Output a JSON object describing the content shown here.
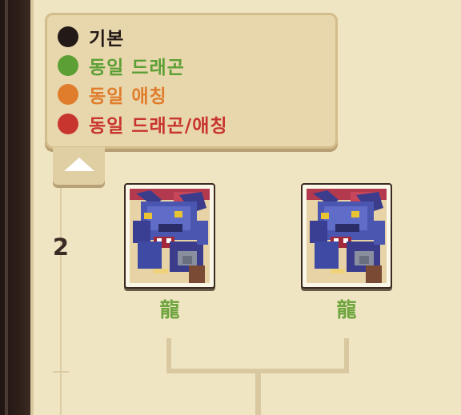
{
  "legend": {
    "items": [
      {
        "label": "기본",
        "color": "#231a17"
      },
      {
        "label": "동일 드래곤",
        "color": "#5c9f34"
      },
      {
        "label": "동일 애칭",
        "color": "#e07d2c"
      },
      {
        "label": "동일 드래곤/애칭",
        "color": "#c8342e"
      }
    ]
  },
  "toggle": {
    "icon": "triangle-up-icon"
  },
  "tree": {
    "level": "2",
    "cards": [
      {
        "name": "龍",
        "icon": "blue-dragon-portrait"
      },
      {
        "name": "龍",
        "icon": "blue-dragon-portrait"
      }
    ]
  }
}
